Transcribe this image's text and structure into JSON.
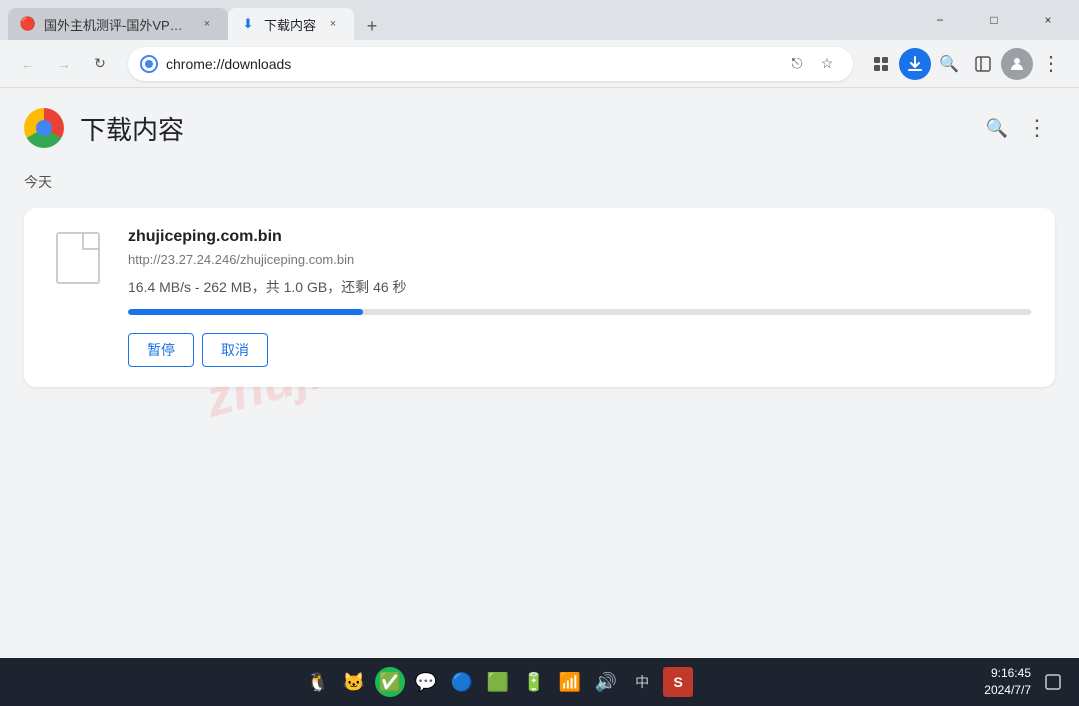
{
  "window": {
    "title_bar_bg": "#dee1e6"
  },
  "tabs": [
    {
      "id": "tab-1",
      "title": "国外主机测评-国外VPS、国…",
      "active": false,
      "favicon": "🔴",
      "close_label": "×"
    },
    {
      "id": "tab-2",
      "title": "下载内容",
      "active": true,
      "favicon": "⬇",
      "close_label": "×"
    }
  ],
  "new_tab_label": "+",
  "window_controls": {
    "minimize": "−",
    "maximize": "□",
    "close": "×"
  },
  "toolbar": {
    "back_label": "←",
    "forward_label": "→",
    "reload_label": "↻",
    "browser_name": "Chromium",
    "address": "chrome://downloads",
    "share_icon": "⎋",
    "bookmark_icon": "☆",
    "extensions_icon": "🧩",
    "download_icon": "⬇",
    "search_icon": "🔍",
    "sidebar_icon": "⬜",
    "profile_icon": "👤",
    "menu_icon": "⋮"
  },
  "page": {
    "title": "下载内容",
    "search_icon": "🔍",
    "more_icon": "⋮",
    "section_today": "今天",
    "watermark": "zhujiceping.com"
  },
  "download": {
    "filename": "zhujiceping.com.bin",
    "url": "http://23.27.24.246/zhujiceping.com.bin",
    "status": "16.4 MB/s - 262 MB，共 1.0 GB，还剩 46 秒",
    "progress_percent": 26,
    "pause_label": "暂停",
    "cancel_label": "取消"
  },
  "taskbar": {
    "icons": [
      "🐧",
      "🐱",
      "✅",
      "💬",
      "🔵",
      "🟩",
      "🔋",
      "📶",
      "🔊",
      "中",
      "🅂"
    ],
    "clock_time": "9:16:45",
    "clock_date": "2024/7/7",
    "notification_icon": "🔔"
  }
}
